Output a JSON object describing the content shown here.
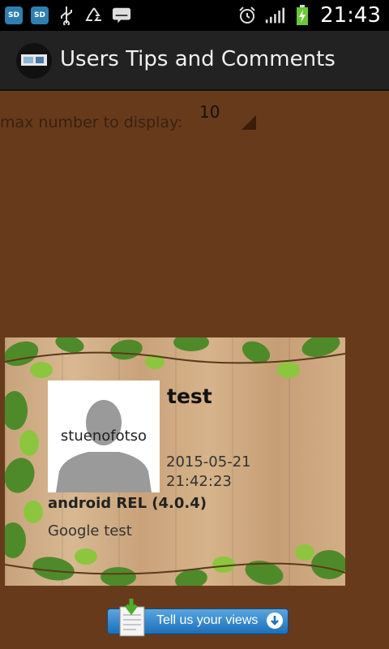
{
  "status_bar": {
    "time": "21:43",
    "left_icons": [
      "sd-card-icon",
      "sd-card-icon",
      "usb-icon",
      "recycle-icon",
      "keyboard-icon"
    ],
    "left_labels": [
      "SD",
      "SD"
    ],
    "right_icons": [
      "alarm-icon",
      "signal-icon",
      "battery-charging-icon"
    ]
  },
  "action_bar": {
    "title": "Users Tips and Comments"
  },
  "filter": {
    "label": "max number to display:",
    "value": "10"
  },
  "comment": {
    "title": "test",
    "username": "stuenofotso",
    "date": "2015-05-21",
    "time": "21:42:23",
    "device": "android REL (4.0.4)",
    "text": "Google test"
  },
  "tell_button": {
    "label": "Tell us your views"
  },
  "colors": {
    "background": "#683a1c",
    "action_bar": "#222222",
    "button_blue": "#1c6fb8"
  }
}
